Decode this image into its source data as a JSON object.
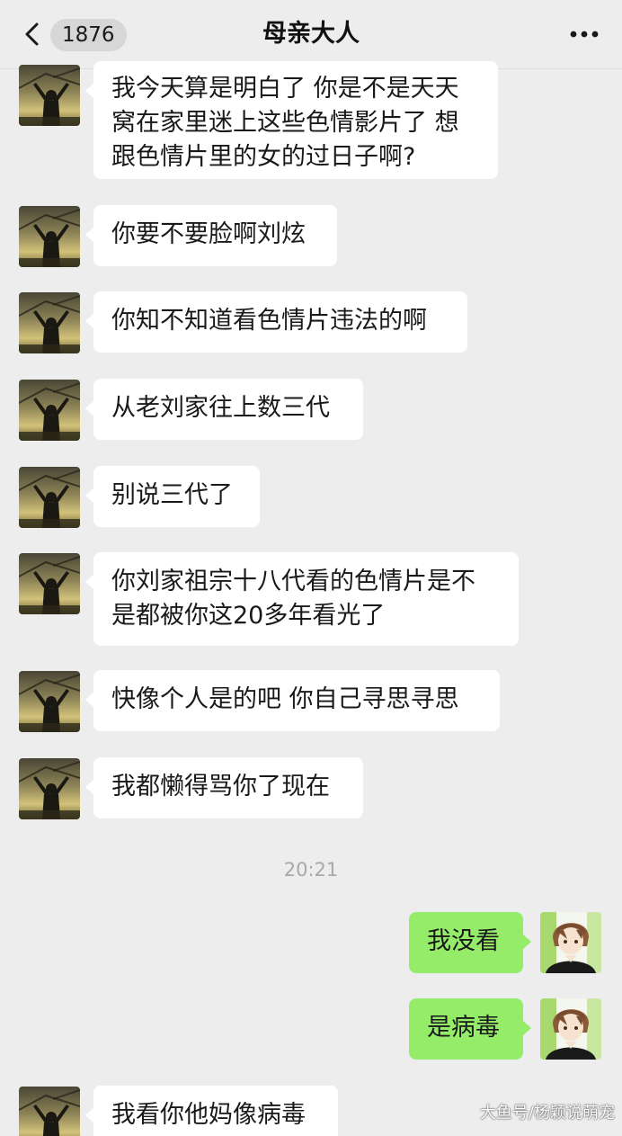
{
  "header": {
    "unread_count": "1876",
    "title": "母亲大人"
  },
  "messages_in_top": [
    {
      "text": "我今天算是明白了 你是不是天天\n窝在家里迷上这些色情影片了 想\n跟色情片里的女的过日子啊?"
    },
    {
      "text": "你要不要脸啊刘炫"
    },
    {
      "text": "你知不知道看色情片违法的啊"
    },
    {
      "text": "从老刘家往上数三代"
    },
    {
      "text": "别说三代了"
    },
    {
      "text": "你刘家祖宗十八代看的色情片是不\n是都被你这20多年看光了"
    },
    {
      "text": "快像个人是的吧 你自己寻思寻思"
    },
    {
      "text": "我都懒得骂你了现在"
    }
  ],
  "timestamp": "20:21",
  "messages_out": [
    {
      "text": "我没看"
    },
    {
      "text": "是病毒"
    }
  ],
  "message_in_bottom": {
    "text": "我看你他妈像病毒"
  },
  "watermark": "大鱼号/杨颖说萌宠",
  "colors": {
    "background": "#ededed",
    "incoming_bubble": "#ffffff",
    "outgoing_bubble": "#95ec69",
    "timestamp_text": "#a8a8a8"
  },
  "icons": {
    "back": "chevron-left-icon",
    "more": "more-dots-icon",
    "contact_avatar": "silhouette-sunset-avatar",
    "self_avatar": "anime-boy-avatar"
  }
}
